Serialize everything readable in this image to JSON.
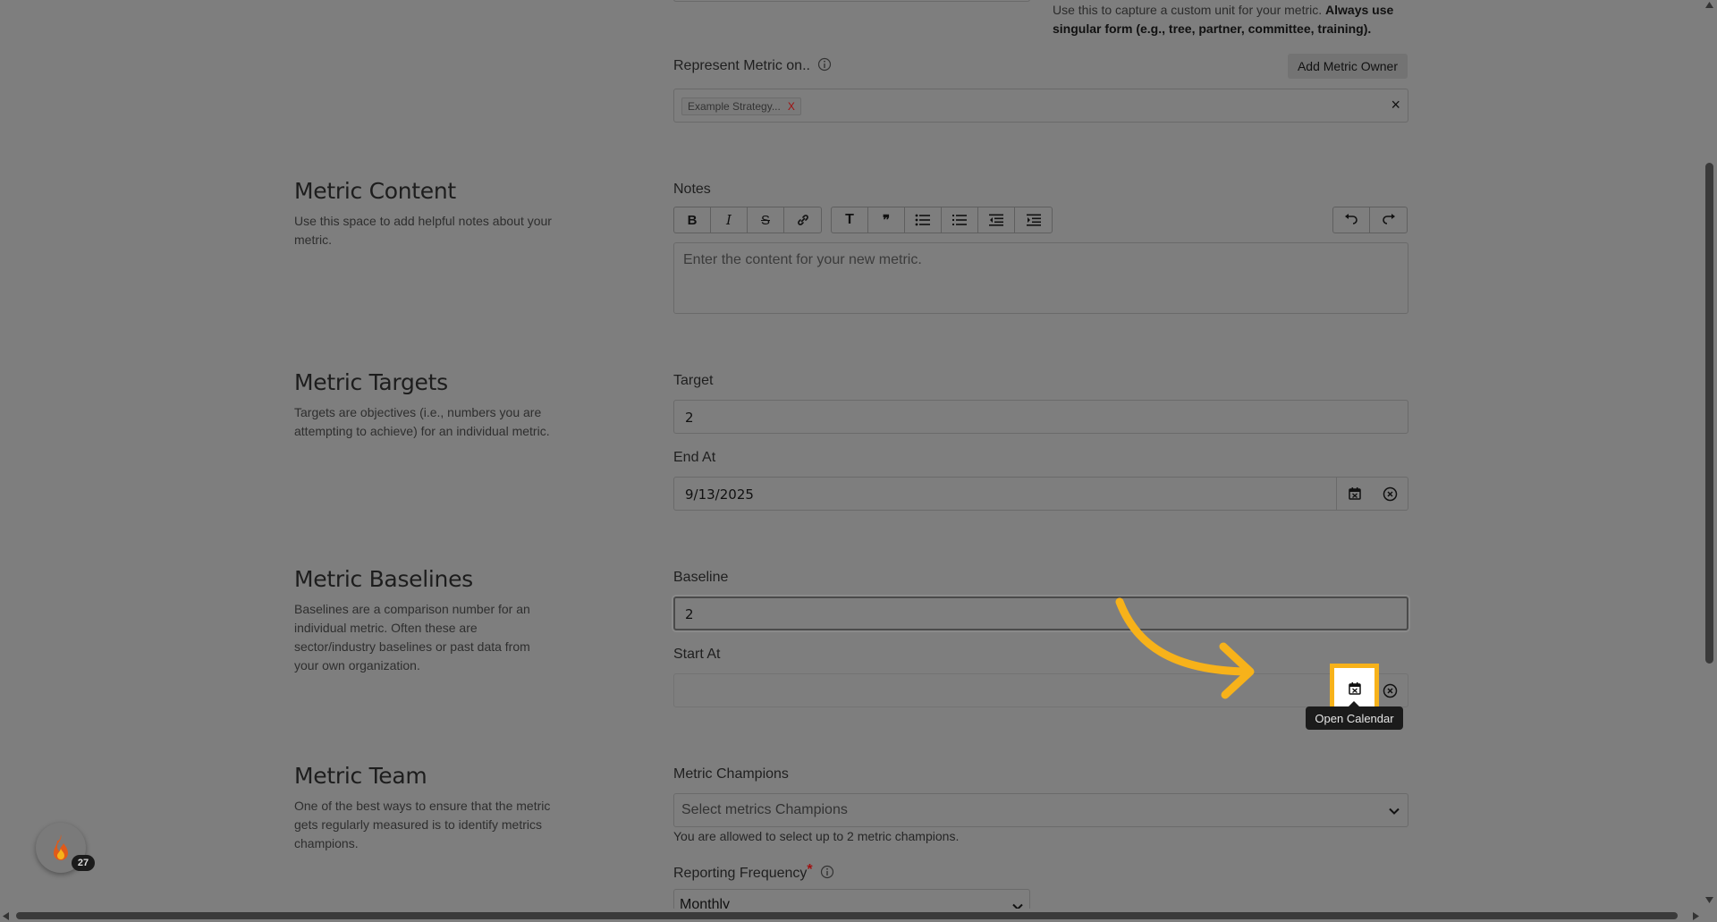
{
  "unit_hint": {
    "text": "Use this to capture a custom unit for your metric.",
    "bold": "Always use singular form (e.g., tree, partner, committee, training)."
  },
  "represent": {
    "label": "Represent Metric on..",
    "add_owner_label": "Add Metric Owner",
    "chip": "Example Strategy...",
    "chip_remove": "X",
    "clear": "×"
  },
  "content": {
    "title": "Metric Content",
    "description": "Use this space to add helpful notes about your metric.",
    "notes_label": "Notes",
    "notes_placeholder": "Enter the content for your new metric."
  },
  "toolbar": {
    "bold": "B",
    "italic": "I",
    "strike": "S",
    "heading": "T",
    "quote": "❞"
  },
  "targets": {
    "title": "Metric Targets",
    "description": "Targets are objectives (i.e., numbers you are attempting to achieve) for an individual metric.",
    "target_label": "Target",
    "target_value": "2",
    "end_label": "End At",
    "end_value": "9/13/2025"
  },
  "baselines": {
    "title": "Metric Baselines",
    "description": "Baselines are a comparison number for an individual metric. Often these are sector/industry baselines or past data from your own organization.",
    "baseline_label": "Baseline",
    "baseline_value": "2",
    "start_label": "Start At",
    "start_value": ""
  },
  "tooltip": "Open Calendar",
  "team": {
    "title": "Metric Team",
    "description": "One of the best ways to ensure that the metric gets regularly measured is to identify metrics champions.",
    "champions_label": "Metric Champions",
    "champions_placeholder": "Select metrics Champions",
    "champions_help": "You are allowed to select up to 2 metric champions.",
    "frequency_label": "Reporting Frequency",
    "frequency_required": "*",
    "frequency_value": "Monthly"
  },
  "fab_badge": "27",
  "colors": {
    "highlight": "#f7b21a",
    "overlay": "#7e7e7e"
  }
}
